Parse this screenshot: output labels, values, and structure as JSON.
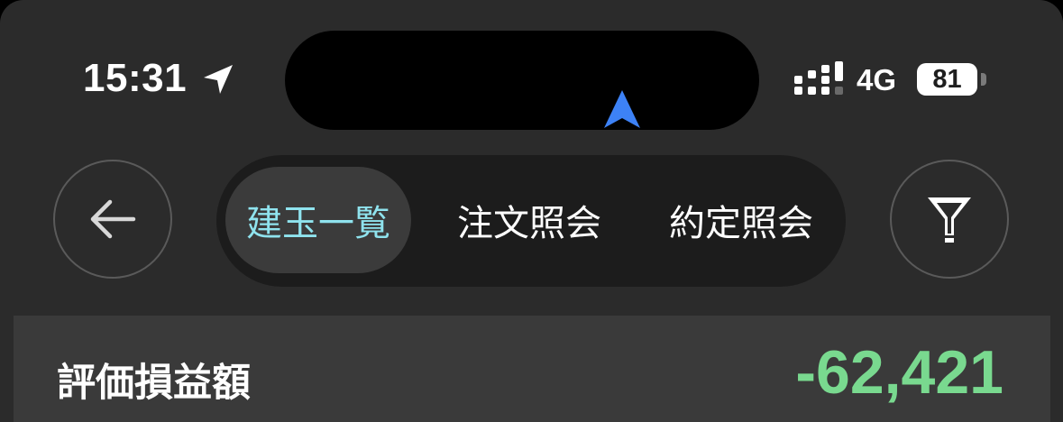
{
  "status_bar": {
    "time": "15:31",
    "network": "4G",
    "battery_level": "81",
    "icons": [
      "location-arrow-icon",
      "signal-icon",
      "battery-icon"
    ]
  },
  "dynamic_island": {
    "icon": "navigation-arrow-icon",
    "icon_color": "#3d82f6"
  },
  "toolbar": {
    "back_icon": "back-arrow-icon",
    "filter_icon": "filter-icon",
    "tabs": [
      {
        "label": "建玉一覧",
        "active": true
      },
      {
        "label": "注文照会",
        "active": false
      },
      {
        "label": "約定照会",
        "active": false
      }
    ],
    "active_color": "#8fe3ee"
  },
  "valuation": {
    "label": "評価損益額",
    "value": "-62,421",
    "value_color": "#79d98f"
  }
}
